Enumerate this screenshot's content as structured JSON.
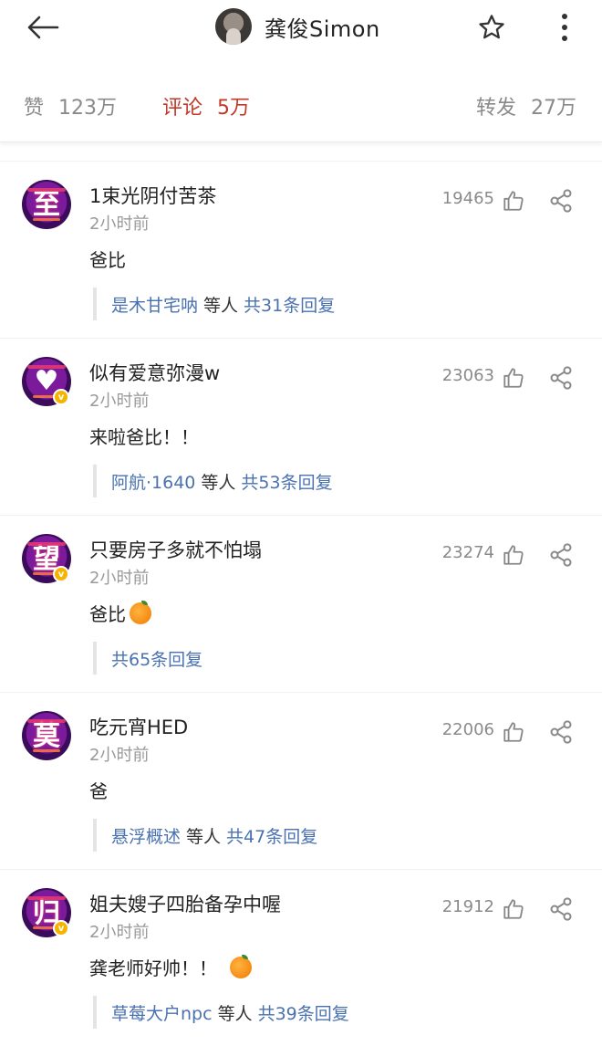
{
  "header": {
    "title": "龚俊Simon",
    "icons": {
      "back": "back-arrow-icon",
      "star": "star-icon",
      "more": "more-vertical-icon"
    }
  },
  "stats": {
    "likes_label": "赞",
    "likes_value": "123万",
    "comments_label": "评论",
    "comments_value": "5万",
    "reposts_label": "转发",
    "reposts_value": "27万",
    "active_color": "#c0392b"
  },
  "comments": [
    {
      "user": "1束光阴付苦茶",
      "avatar_char": "至",
      "time": "2小时前",
      "text": "爸比",
      "likes": "19465",
      "reply_user": "是木甘宅呐",
      "reply_mid": "等人",
      "reply_total": "共31条回复"
    },
    {
      "user": "似有爱意弥漫w",
      "avatar_char": "♥",
      "time": "2小时前",
      "text": "来啦爸比！！",
      "likes": "23063",
      "reply_user": "阿航·1640",
      "reply_mid": "等人",
      "reply_total": "共53条回复"
    },
    {
      "user": "只要房子多就不怕塌",
      "avatar_char": "望",
      "time": "2小时前",
      "text": "爸比",
      "likes": "23274",
      "reply_total": "共65条回复"
    },
    {
      "user": "吃元宵HED",
      "avatar_char": "莫",
      "time": "2小时前",
      "text": "爸",
      "likes": "22006",
      "reply_user": "悬浮概述",
      "reply_mid": "等人",
      "reply_total": "共47条回复"
    },
    {
      "user": "姐夫嫂子四胎备孕中喔",
      "avatar_char": "归",
      "time": "2小时前",
      "text": "龚老师好帅！！",
      "likes": "21912",
      "reply_user": "草莓大户npc",
      "reply_mid": "等人",
      "reply_total": "共39条回复"
    }
  ],
  "icon_names": [
    "like-icon",
    "share-icon",
    "orange-emoji-icon",
    "verified-badge-icon"
  ]
}
